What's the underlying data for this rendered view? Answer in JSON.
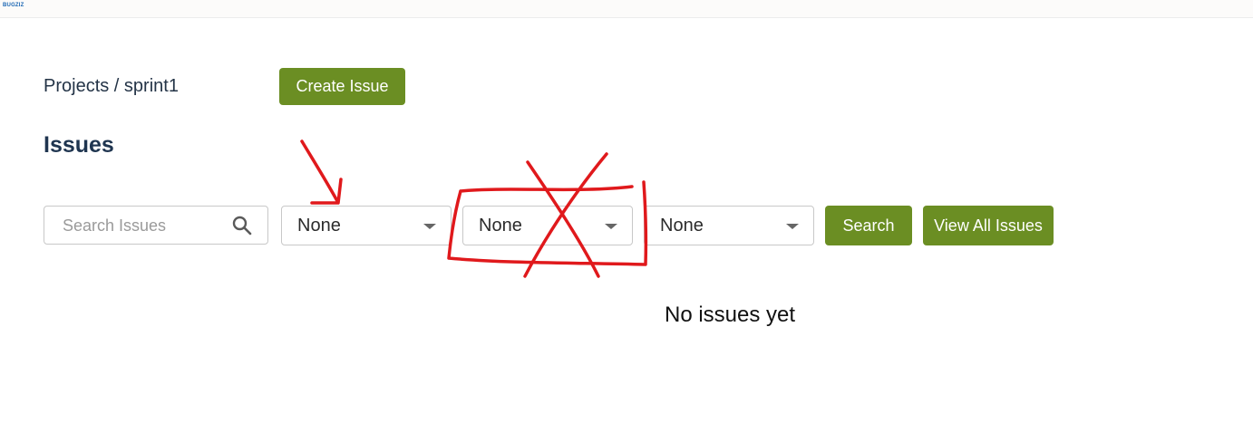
{
  "header": {
    "logo_text": "BUGZIZ"
  },
  "breadcrumb": "Projects / sprint1",
  "actions": {
    "create_issue_label": "Create Issue"
  },
  "page_title": "Issues",
  "filters": {
    "search_placeholder": "Search Issues",
    "select_1_value": "None",
    "select_2_value": "None",
    "select_3_value": "None",
    "search_button_label": "Search",
    "view_all_button_label": "View All Issues"
  },
  "empty_state": "No issues yet",
  "colors": {
    "button_green": "#6b8e23",
    "annotation_red": "#e0191c",
    "title_navy": "#1f3550"
  },
  "icons": {
    "search": "search-icon",
    "dropdown": "chevron-down-icon"
  }
}
